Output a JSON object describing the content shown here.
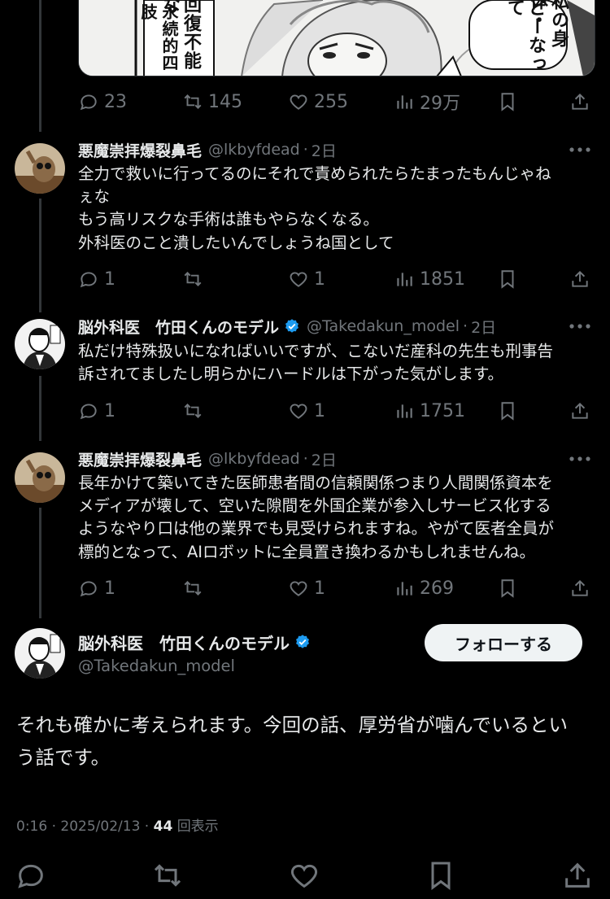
{
  "top_tweet": {
    "image_alt": "manga-panel",
    "manga_text_1": "回復不能な",
    "manga_text_2": "永続的四肢",
    "manga_text_3": "私の身体・",
    "manga_text_4": "どーなって",
    "metrics": {
      "replies": "23",
      "reposts": "145",
      "likes": "255",
      "views": "29万"
    }
  },
  "replies": [
    {
      "name": "悪魔崇拝爆裂鼻毛",
      "handle": "@lkbyfdead",
      "time": "2日",
      "verified": false,
      "lines": [
        "全力で救いに行ってるのにそれで責められたらたまったもんじゃね",
        "ぇな",
        "もう高リスクな手術は誰もやらなくなる。",
        "外科医のこと潰したいんでしょうね国として"
      ],
      "metrics": {
        "replies": "1",
        "reposts": "",
        "likes": "1",
        "views": "1851"
      }
    },
    {
      "name": "脳外科医　竹田くんのモデル",
      "handle": "@Takedakun_model",
      "time": "2日",
      "verified": true,
      "lines": [
        "私だけ特殊扱いになればいいですが、こないだ産科の先生も刑事告",
        "訴されてましたし明らかにハードルは下がった気がします。"
      ],
      "metrics": {
        "replies": "1",
        "reposts": "",
        "likes": "1",
        "views": "1751"
      }
    },
    {
      "name": "悪魔崇拝爆裂鼻毛",
      "handle": "@lkbyfdead",
      "time": "2日",
      "verified": false,
      "lines": [
        "長年かけて築いてきた医師患者間の信頼関係つまり人間関係資本を",
        "メディアが壊して、空いた隙間を外国企業が参入しサービス化する",
        "ようなやり口は他の業界でも見受けられますね。やがて医者全員が",
        "標的となって、AIロボットに全員置き換わるかもしれませんね。"
      ],
      "metrics": {
        "replies": "1",
        "reposts": "",
        "likes": "1",
        "views": "269"
      }
    }
  ],
  "main_tweet": {
    "name": "脳外科医　竹田くんのモデル",
    "handle": "@Takedakun_model",
    "follow_label": "フォローする",
    "lines": [
      "それも確かに考えられます。今回の話、厚労省が噛んでいるとい",
      "う話です。"
    ],
    "time": "0:16",
    "date": "2025/02/13",
    "view_count": "44",
    "view_label": "回表示"
  },
  "colors": {
    "background": "#000000",
    "text": "#e7e9ea",
    "muted": "#71767b",
    "verified": "#1d9bf0",
    "follow_bg": "#eff3f4"
  }
}
